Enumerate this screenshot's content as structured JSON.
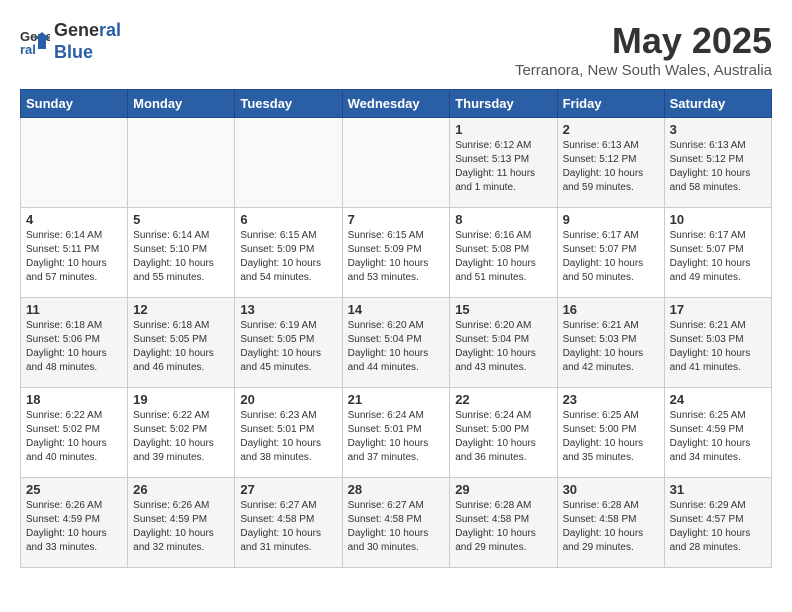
{
  "header": {
    "logo_line1": "General",
    "logo_line2": "Blue",
    "month_title": "May 2025",
    "location": "Terranora, New South Wales, Australia"
  },
  "weekdays": [
    "Sunday",
    "Monday",
    "Tuesday",
    "Wednesday",
    "Thursday",
    "Friday",
    "Saturday"
  ],
  "weeks": [
    [
      {
        "day": "",
        "info": ""
      },
      {
        "day": "",
        "info": ""
      },
      {
        "day": "",
        "info": ""
      },
      {
        "day": "",
        "info": ""
      },
      {
        "day": "1",
        "info": "Sunrise: 6:12 AM\nSunset: 5:13 PM\nDaylight: 11 hours\nand 1 minute."
      },
      {
        "day": "2",
        "info": "Sunrise: 6:13 AM\nSunset: 5:12 PM\nDaylight: 10 hours\nand 59 minutes."
      },
      {
        "day": "3",
        "info": "Sunrise: 6:13 AM\nSunset: 5:12 PM\nDaylight: 10 hours\nand 58 minutes."
      }
    ],
    [
      {
        "day": "4",
        "info": "Sunrise: 6:14 AM\nSunset: 5:11 PM\nDaylight: 10 hours\nand 57 minutes."
      },
      {
        "day": "5",
        "info": "Sunrise: 6:14 AM\nSunset: 5:10 PM\nDaylight: 10 hours\nand 55 minutes."
      },
      {
        "day": "6",
        "info": "Sunrise: 6:15 AM\nSunset: 5:09 PM\nDaylight: 10 hours\nand 54 minutes."
      },
      {
        "day": "7",
        "info": "Sunrise: 6:15 AM\nSunset: 5:09 PM\nDaylight: 10 hours\nand 53 minutes."
      },
      {
        "day": "8",
        "info": "Sunrise: 6:16 AM\nSunset: 5:08 PM\nDaylight: 10 hours\nand 51 minutes."
      },
      {
        "day": "9",
        "info": "Sunrise: 6:17 AM\nSunset: 5:07 PM\nDaylight: 10 hours\nand 50 minutes."
      },
      {
        "day": "10",
        "info": "Sunrise: 6:17 AM\nSunset: 5:07 PM\nDaylight: 10 hours\nand 49 minutes."
      }
    ],
    [
      {
        "day": "11",
        "info": "Sunrise: 6:18 AM\nSunset: 5:06 PM\nDaylight: 10 hours\nand 48 minutes."
      },
      {
        "day": "12",
        "info": "Sunrise: 6:18 AM\nSunset: 5:05 PM\nDaylight: 10 hours\nand 46 minutes."
      },
      {
        "day": "13",
        "info": "Sunrise: 6:19 AM\nSunset: 5:05 PM\nDaylight: 10 hours\nand 45 minutes."
      },
      {
        "day": "14",
        "info": "Sunrise: 6:20 AM\nSunset: 5:04 PM\nDaylight: 10 hours\nand 44 minutes."
      },
      {
        "day": "15",
        "info": "Sunrise: 6:20 AM\nSunset: 5:04 PM\nDaylight: 10 hours\nand 43 minutes."
      },
      {
        "day": "16",
        "info": "Sunrise: 6:21 AM\nSunset: 5:03 PM\nDaylight: 10 hours\nand 42 minutes."
      },
      {
        "day": "17",
        "info": "Sunrise: 6:21 AM\nSunset: 5:03 PM\nDaylight: 10 hours\nand 41 minutes."
      }
    ],
    [
      {
        "day": "18",
        "info": "Sunrise: 6:22 AM\nSunset: 5:02 PM\nDaylight: 10 hours\nand 40 minutes."
      },
      {
        "day": "19",
        "info": "Sunrise: 6:22 AM\nSunset: 5:02 PM\nDaylight: 10 hours\nand 39 minutes."
      },
      {
        "day": "20",
        "info": "Sunrise: 6:23 AM\nSunset: 5:01 PM\nDaylight: 10 hours\nand 38 minutes."
      },
      {
        "day": "21",
        "info": "Sunrise: 6:24 AM\nSunset: 5:01 PM\nDaylight: 10 hours\nand 37 minutes."
      },
      {
        "day": "22",
        "info": "Sunrise: 6:24 AM\nSunset: 5:00 PM\nDaylight: 10 hours\nand 36 minutes."
      },
      {
        "day": "23",
        "info": "Sunrise: 6:25 AM\nSunset: 5:00 PM\nDaylight: 10 hours\nand 35 minutes."
      },
      {
        "day": "24",
        "info": "Sunrise: 6:25 AM\nSunset: 4:59 PM\nDaylight: 10 hours\nand 34 minutes."
      }
    ],
    [
      {
        "day": "25",
        "info": "Sunrise: 6:26 AM\nSunset: 4:59 PM\nDaylight: 10 hours\nand 33 minutes."
      },
      {
        "day": "26",
        "info": "Sunrise: 6:26 AM\nSunset: 4:59 PM\nDaylight: 10 hours\nand 32 minutes."
      },
      {
        "day": "27",
        "info": "Sunrise: 6:27 AM\nSunset: 4:58 PM\nDaylight: 10 hours\nand 31 minutes."
      },
      {
        "day": "28",
        "info": "Sunrise: 6:27 AM\nSunset: 4:58 PM\nDaylight: 10 hours\nand 30 minutes."
      },
      {
        "day": "29",
        "info": "Sunrise: 6:28 AM\nSunset: 4:58 PM\nDaylight: 10 hours\nand 29 minutes."
      },
      {
        "day": "30",
        "info": "Sunrise: 6:28 AM\nSunset: 4:58 PM\nDaylight: 10 hours\nand 29 minutes."
      },
      {
        "day": "31",
        "info": "Sunrise: 6:29 AM\nSunset: 4:57 PM\nDaylight: 10 hours\nand 28 minutes."
      }
    ]
  ]
}
